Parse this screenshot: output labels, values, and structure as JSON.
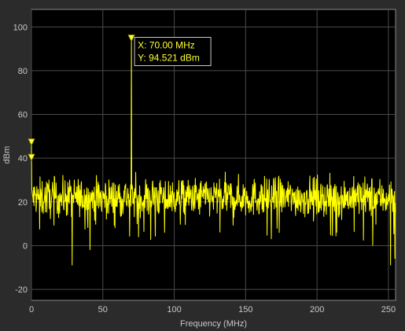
{
  "chart_data": {
    "type": "line",
    "title": "",
    "xlabel": "Frequency (MHz)",
    "ylabel": "dBm",
    "xlim": [
      0,
      255
    ],
    "ylim": [
      -25,
      108
    ],
    "grid": true,
    "x_ticks": [
      0,
      50,
      100,
      150,
      200,
      250
    ],
    "y_ticks": [
      -20,
      0,
      20,
      40,
      60,
      80,
      100
    ],
    "background": "#000000",
    "figure_background": "#2b2b2b",
    "trace_color": "#ffff00",
    "series": [
      {
        "description": "noise floor with spike",
        "noise_floor_mean": 22,
        "noise_floor_range": [
          10,
          34
        ],
        "x_step": 0.25,
        "spikes": [
          {
            "x": 0,
            "y": 47
          },
          {
            "x": 0,
            "y": 40
          },
          {
            "x": 70,
            "y": 94.521
          }
        ],
        "dips": [
          {
            "x": 28.5,
            "y": -9
          },
          {
            "x": 41,
            "y": -2
          },
          {
            "x": 251.5,
            "y": -9
          },
          {
            "x": 254.5,
            "y": -6
          },
          {
            "x": 239,
            "y": 0
          },
          {
            "x": 168,
            "y": 3
          }
        ]
      }
    ],
    "markers": [
      {
        "x": 0,
        "y": 47
      },
      {
        "x": 0,
        "y": 40
      },
      {
        "x": 70,
        "y": 94.521
      }
    ],
    "datatip": {
      "x_line": "X: 70.00 MHz",
      "y_line": "Y:  94.521 dBm",
      "anchor_x": 70,
      "anchor_y": 94.521
    }
  }
}
